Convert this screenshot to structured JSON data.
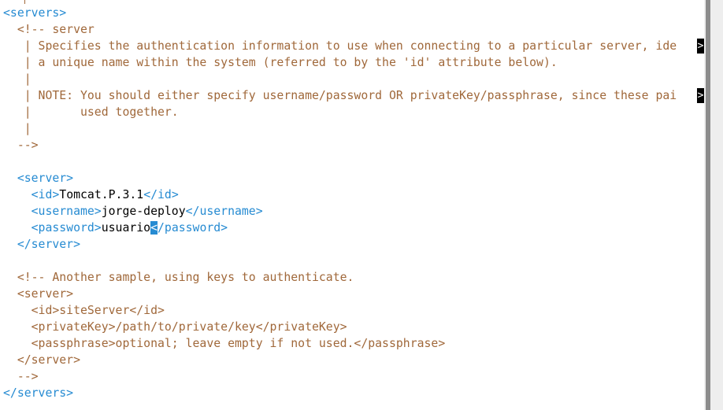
{
  "editor": {
    "lines": [
      {
        "parts": [
          {
            "c": "tag",
            "t": "<servers>"
          }
        ]
      },
      {
        "parts": [
          {
            "c": "cmt",
            "t": "  <!-- server"
          }
        ]
      },
      {
        "parts": [
          {
            "c": "cmt",
            "t": "   | Specifies the authentication information to use when connecting to a particular server, ide"
          }
        ],
        "wrap": true
      },
      {
        "parts": [
          {
            "c": "cmt",
            "t": "   | a unique name within the system (referred to by the 'id' attribute below)."
          }
        ]
      },
      {
        "parts": [
          {
            "c": "cmt",
            "t": "   |"
          }
        ]
      },
      {
        "parts": [
          {
            "c": "cmt",
            "t": "   | NOTE: You should either specify username/password OR privateKey/passphrase, since these pai"
          }
        ],
        "wrap": true
      },
      {
        "parts": [
          {
            "c": "cmt",
            "t": "   |       used together."
          }
        ]
      },
      {
        "parts": [
          {
            "c": "cmt",
            "t": "   |"
          }
        ]
      },
      {
        "parts": [
          {
            "c": "cmt",
            "t": "  -->"
          }
        ]
      },
      {
        "parts": [
          {
            "c": "txt",
            "t": ""
          }
        ]
      },
      {
        "parts": [
          {
            "c": "tag",
            "t": "  <server>"
          }
        ]
      },
      {
        "parts": [
          {
            "c": "tag",
            "t": "    <id>"
          },
          {
            "c": "txt",
            "t": "Tomcat.P.3.1"
          },
          {
            "c": "tag",
            "t": "</id>"
          }
        ]
      },
      {
        "parts": [
          {
            "c": "tag",
            "t": "    <username>"
          },
          {
            "c": "txt",
            "t": "jorge-deploy"
          },
          {
            "c": "tag",
            "t": "</username>"
          }
        ]
      },
      {
        "parts": [
          {
            "c": "tag",
            "t": "    <password>"
          },
          {
            "c": "txt",
            "t": "usuario"
          },
          {
            "c": "cursor",
            "t": "<"
          },
          {
            "c": "tag",
            "t": "/password>"
          }
        ]
      },
      {
        "parts": [
          {
            "c": "tag",
            "t": "  </server>"
          }
        ]
      },
      {
        "parts": [
          {
            "c": "txt",
            "t": ""
          }
        ]
      },
      {
        "parts": [
          {
            "c": "cmt",
            "t": "  <!-- Another sample, using keys to authenticate."
          }
        ]
      },
      {
        "parts": [
          {
            "c": "cmt",
            "t": "  <server>"
          }
        ]
      },
      {
        "parts": [
          {
            "c": "cmt",
            "t": "    <id>siteServer</id>"
          }
        ]
      },
      {
        "parts": [
          {
            "c": "cmt",
            "t": "    <privateKey>/path/to/private/key</privateKey>"
          }
        ]
      },
      {
        "parts": [
          {
            "c": "cmt",
            "t": "    <passphrase>optional; leave empty if not used.</passphrase>"
          }
        ]
      },
      {
        "parts": [
          {
            "c": "cmt",
            "t": "  </server>"
          }
        ]
      },
      {
        "parts": [
          {
            "c": "cmt",
            "t": "  -->"
          }
        ]
      },
      {
        "parts": [
          {
            "c": "tag",
            "t": "</servers>"
          }
        ]
      }
    ],
    "wrap_marker": ">"
  },
  "colors": {
    "tag": "#268bd2",
    "comment": "#a0683a",
    "text": "#000000",
    "cursor": "#268bd2"
  },
  "icons": {
    "wrap_marker": "line-continuation-icon"
  }
}
